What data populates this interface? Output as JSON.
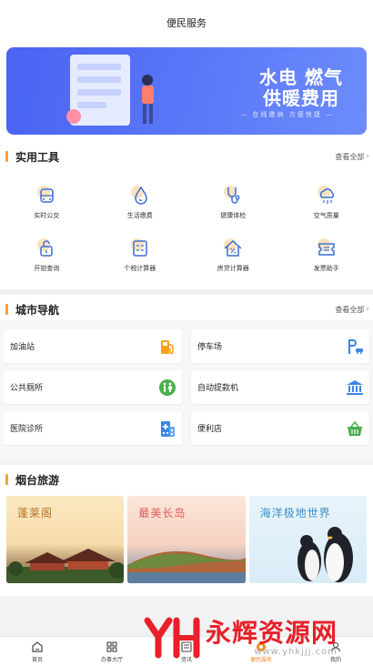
{
  "header": {
    "title": "便民服务"
  },
  "banner": {
    "line1": "水电 燃气",
    "line2": "供暖费用",
    "sub": "— 在线缴纳 方便快捷 —"
  },
  "tools_section": {
    "title": "实用工具",
    "more": "查看全部",
    "items": [
      {
        "label": "实时公交",
        "icon": "bus-icon"
      },
      {
        "label": "生活缴费",
        "icon": "water-drop-icon"
      },
      {
        "label": "健康体检",
        "icon": "stethoscope-icon"
      },
      {
        "label": "空气质量",
        "icon": "cloud-icon"
      },
      {
        "label": "开锁查询",
        "icon": "lock-icon"
      },
      {
        "label": "个税计算器",
        "icon": "calculator-icon"
      },
      {
        "label": "房贷计算器",
        "icon": "house-percent-icon"
      },
      {
        "label": "发票助手",
        "icon": "ticket-icon"
      }
    ]
  },
  "city_section": {
    "title": "城市导航",
    "more": "查看全部",
    "items": [
      {
        "label": "加油站",
        "icon": "gas-pump-icon"
      },
      {
        "label": "停车场",
        "icon": "parking-icon"
      },
      {
        "label": "公共厕所",
        "icon": "restroom-icon"
      },
      {
        "label": "自动提款机",
        "icon": "bank-icon"
      },
      {
        "label": "医院诊所",
        "icon": "hospital-icon"
      },
      {
        "label": "便利店",
        "icon": "basket-icon"
      }
    ]
  },
  "tour_section": {
    "title": "烟台旅游",
    "items": [
      {
        "label": "蓬莱阁"
      },
      {
        "label": "最美长岛"
      },
      {
        "label": "海洋极地世界"
      }
    ]
  },
  "tabbar": {
    "items": [
      {
        "label": "首页",
        "icon": "home-icon"
      },
      {
        "label": "办事大厅",
        "icon": "grid-icon"
      },
      {
        "label": "资讯",
        "icon": "news-icon"
      },
      {
        "label": "便民服务",
        "icon": "service-icon"
      },
      {
        "label": "我的",
        "icon": "user-icon"
      }
    ],
    "active_index": 3
  },
  "watermark": {
    "logo": "YH",
    "main": "永辉资源网",
    "url": "www.yhkjjj.com"
  },
  "colors": {
    "accent": "#f2a33a",
    "banner": "#5b78f8",
    "tab_active": "#f28a1f",
    "watermark": "#e8202a"
  }
}
